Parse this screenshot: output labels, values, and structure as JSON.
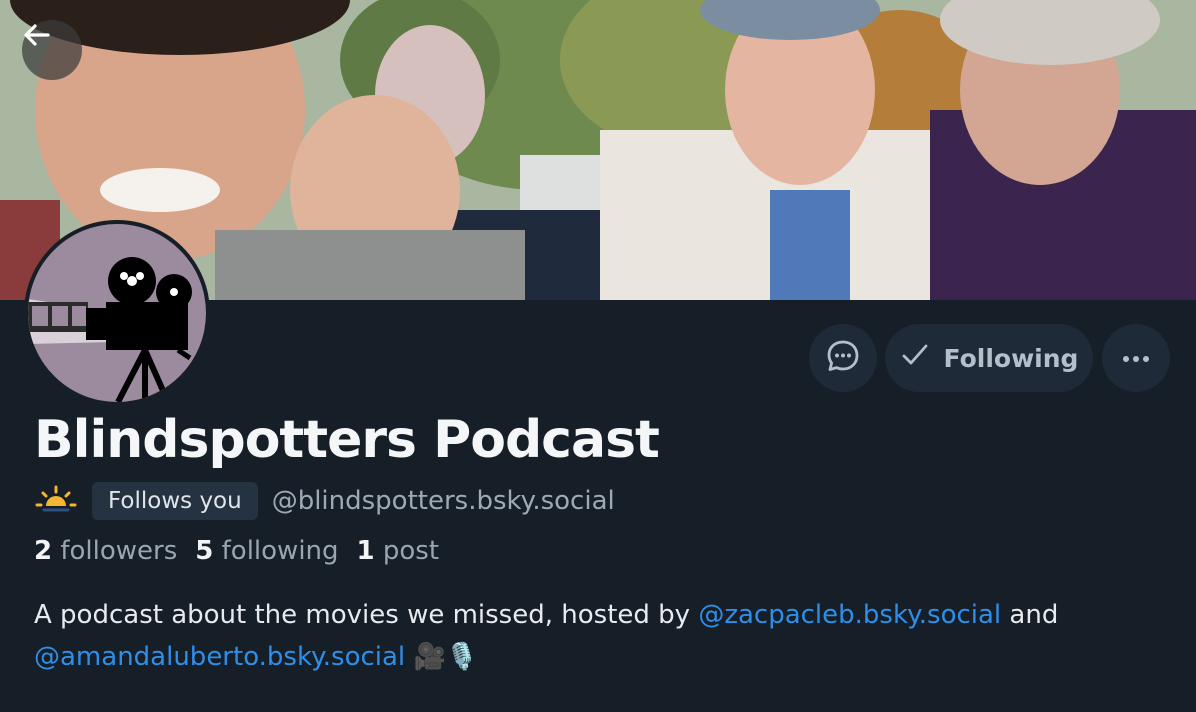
{
  "profile": {
    "display_name": "Blindspotters Podcast",
    "follows_you_label": "Follows you",
    "handle": "@blindspotters.bsky.social",
    "stats": {
      "followers_count": "2",
      "followers_label": "followers",
      "following_count": "5",
      "following_label": "following",
      "posts_count": "1",
      "posts_label": "post"
    },
    "bio": {
      "text_1": "A podcast about the movies we missed, hosted by ",
      "mention_1": "@zacpacleb.bsky.social",
      "text_2": " and",
      "mention_2": "@amandaluberto.bsky.social",
      "emoji": "🎥🎙️"
    }
  },
  "actions": {
    "following_label": "Following"
  },
  "icons": {
    "back": "arrow-left-icon",
    "message": "chat-bubble-icon",
    "following": "checkmark-icon",
    "more": "ellipsis-icon",
    "status": "sunrise-icon"
  },
  "colors": {
    "background": "#161e27",
    "button": "#1e2a37",
    "link": "#2f8ee8",
    "muted_text": "#9aa5b1"
  }
}
